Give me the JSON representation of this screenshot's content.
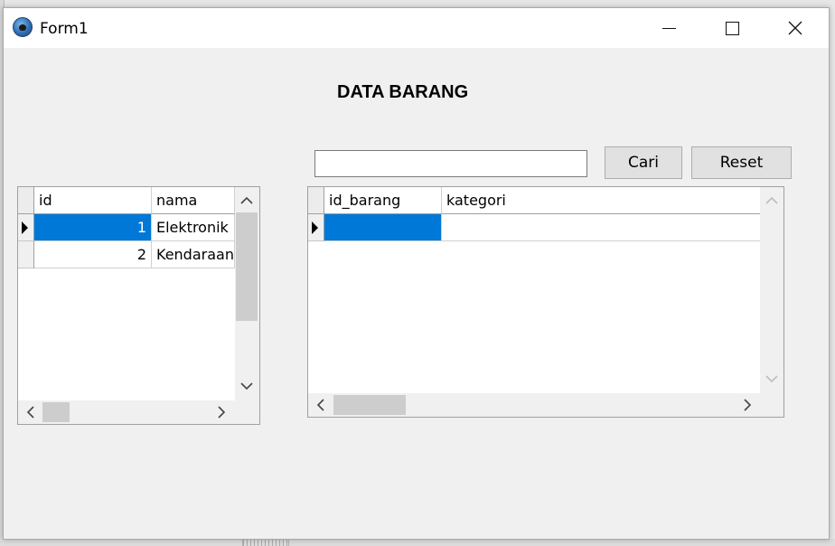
{
  "window": {
    "title": "Form1"
  },
  "form": {
    "heading": "DATA BARANG",
    "search": {
      "value": "",
      "placeholder": ""
    },
    "cari_label": "Cari",
    "reset_label": "Reset"
  },
  "grid_left": {
    "columns": [
      "id",
      "nama"
    ],
    "rows": [
      {
        "id": "1",
        "nama": "Elektronik",
        "selected": true
      },
      {
        "id": "2",
        "nama": "Kendaraan",
        "selected": false
      }
    ]
  },
  "grid_right": {
    "columns": [
      "id_barang",
      "kategori"
    ],
    "rows": [
      {
        "id_barang": "",
        "kategori": "",
        "selected": true
      }
    ]
  },
  "colors": {
    "selection": "#0078d7",
    "window_bg": "#f0f0f0",
    "titlebar_bg": "#ffffff"
  },
  "icons": [
    "paw-app-icon",
    "minimize-icon",
    "maximize-icon",
    "close-icon",
    "chevron-up-icon",
    "chevron-down-icon",
    "chevron-left-icon",
    "chevron-right-icon",
    "row-selector-arrow-icon"
  ]
}
